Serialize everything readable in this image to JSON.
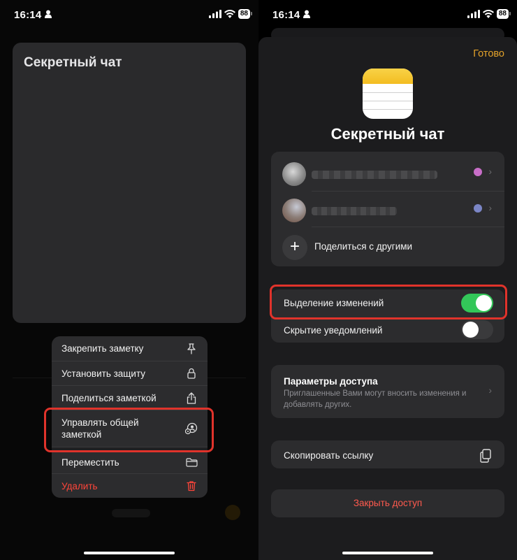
{
  "status_bar": {
    "time": "16:14",
    "battery": "88"
  },
  "left": {
    "note_title": "Секретный чат",
    "context_menu": [
      {
        "label": "Закрепить заметку",
        "icon": "pin-icon"
      },
      {
        "label": "Установить защиту",
        "icon": "lock-icon"
      },
      {
        "label": "Поделиться заметкой",
        "icon": "share-icon"
      },
      {
        "label": "Управлять общей заметкой",
        "icon": "manage-shared-icon"
      },
      {
        "label": "Переместить",
        "icon": "folder-icon"
      },
      {
        "label": "Удалить",
        "icon": "trash-icon"
      }
    ]
  },
  "right": {
    "done_label": "Готово",
    "title": "Секретный чат",
    "participants": [
      {
        "color": "#c86ec8"
      },
      {
        "color": "#7b86c6"
      }
    ],
    "share_label": "Поделиться с другими",
    "highlight_label": "Выделение изменений",
    "highlight_on": true,
    "hide_alerts_label": "Скрытие уведомлений",
    "hide_alerts_on": false,
    "access_title": "Параметры доступа",
    "access_desc": "Приглашенные Вами могут вносить изменения и добавлять других.",
    "copy_link_label": "Скопировать ссылку",
    "close_access_label": "Закрыть доступ"
  },
  "colors": {
    "accent": "#e3a22a",
    "toggle_on": "#33c759",
    "danger": "#ff453a",
    "highlight_box": "#e0332b"
  }
}
